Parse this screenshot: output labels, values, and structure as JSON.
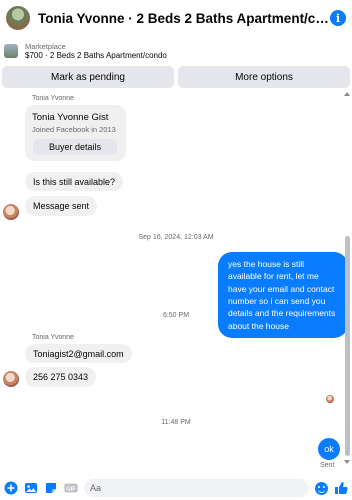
{
  "header": {
    "title": "Tonia Yvonne · 2 Beds 2 Baths Apartment/condo",
    "info_icon": "info-icon"
  },
  "listing": {
    "marketplace_label": "Marketplace",
    "item": "$700 · 2 Beds 2 Baths Apartment/condo"
  },
  "actions": {
    "mark_pending": "Mark as pending",
    "more_options": "More options"
  },
  "thread": {
    "sender_top": "Tonia Yvonne",
    "profile_card": {
      "name": "Tonia Yvonne Gist",
      "joined": "Joined Facebook in 2013",
      "button": "Buyer details"
    },
    "msg_available": "Is this still available?",
    "msg_sent": "Message sent",
    "timestamp1": "Sep 16, 2024, 12:03 AM",
    "outgoing_reply": "yes the house is still available for rent, let me have your email  and contact number so i can send you details and the requirements about the house",
    "timestamp2": "6:50 PM",
    "sender_bottom": "Tonia Yvonne",
    "msg_email": "Toniagist2@gmail.com",
    "msg_phone": "256 275 0343",
    "timestamp3": "11:48 PM",
    "outgoing_ok": "ok",
    "sent_status": "Sent"
  },
  "composer": {
    "placeholder": "Aa",
    "icons": [
      "add-icon",
      "photo-icon",
      "sticker-icon",
      "gif-icon",
      "emoji-icon",
      "like-icon"
    ]
  },
  "colors": {
    "accent": "#0a7cff",
    "bubble_gray": "#f0f0f0",
    "button_gray": "#e4e6eb",
    "muted_text": "#65676b"
  }
}
